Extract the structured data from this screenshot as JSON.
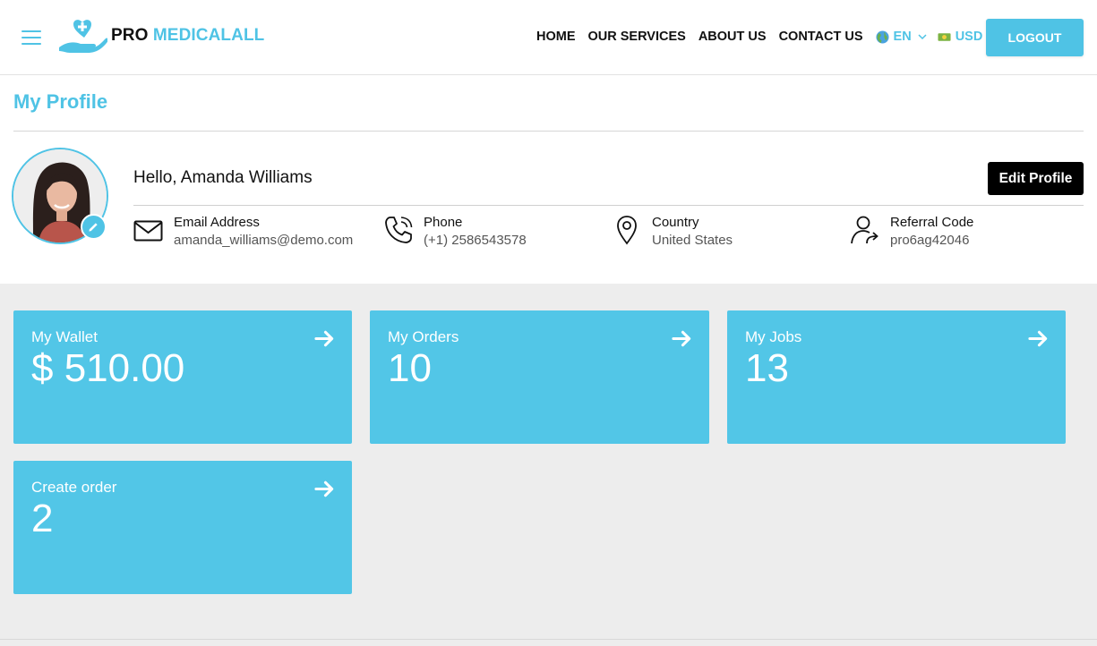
{
  "header": {
    "logo": {
      "pro": "PRO",
      "brand": "MEDICALALL"
    },
    "nav": [
      "HOME",
      "OUR SERVICES",
      "ABOUT US",
      "CONTACT US"
    ],
    "language": {
      "value": "EN",
      "icon": "globe-icon"
    },
    "currency": {
      "value": "USD",
      "icon": "banknote-icon"
    },
    "logout_label": "LOGOUT"
  },
  "profile": {
    "page_title": "My Profile",
    "greeting": "Hello, Amanda Williams",
    "edit_label": "Edit Profile",
    "email": {
      "label": "Email Address",
      "value": "amanda_williams@demo.com",
      "icon": "envelope-icon"
    },
    "phone": {
      "label": "Phone",
      "value": "(+1) 2586543578",
      "icon": "phone-icon"
    },
    "country": {
      "label": "Country",
      "value": "United States",
      "icon": "map-pin-icon"
    },
    "referral": {
      "label": "Referral Code",
      "value": "pro6ag42046",
      "icon": "user-share-icon"
    }
  },
  "cards": [
    {
      "label": "My Wallet",
      "value": "$ 510.00"
    },
    {
      "label": "My Orders",
      "value": "10"
    },
    {
      "label": "My Jobs",
      "value": "13"
    },
    {
      "label": "Create order",
      "value": "2"
    }
  ],
  "colors": {
    "accent": "#4fc3e5",
    "card": "#52c6e7",
    "background": "#ededed",
    "button_dark": "#000000"
  }
}
